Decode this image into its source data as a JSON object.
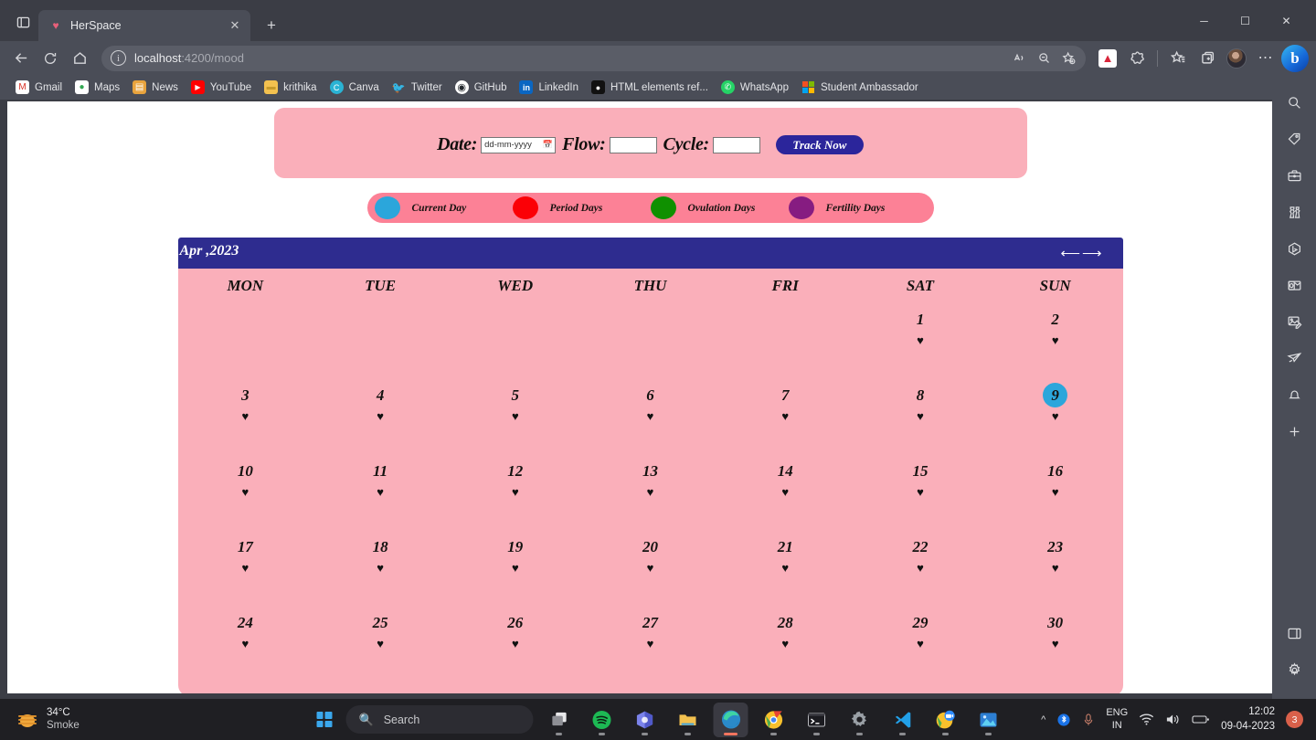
{
  "browser": {
    "tab": {
      "title": "HerSpace",
      "favicon": "heart-favicon",
      "close": "✕"
    },
    "new_tab": "+",
    "window_controls": {
      "minimize": "─",
      "maximize": "☐",
      "close": "✕"
    },
    "address": {
      "protocol_host": "localhost",
      "path": ":4200/mood",
      "info_icon": "i"
    },
    "bookmarks": [
      {
        "label": "Gmail",
        "icon": "gmail-icon",
        "glyph": "M",
        "bg": "#ffffff",
        "fg": "#d93025"
      },
      {
        "label": "Maps",
        "icon": "maps-icon",
        "glyph": "▼",
        "bg": "#ffffff",
        "fg": "#34a853"
      },
      {
        "label": "News",
        "icon": "news-icon",
        "glyph": "▤",
        "bg": "#e8a33d",
        "fg": "#ffffff"
      },
      {
        "label": "YouTube",
        "icon": "youtube-icon",
        "glyph": "▶",
        "bg": "#ff0000",
        "fg": "#ffffff"
      },
      {
        "label": "krithika",
        "icon": "folder-icon",
        "glyph": "▬",
        "bg": "#f3c14f",
        "fg": "#c79a2a"
      },
      {
        "label": "Canva",
        "icon": "canva-icon",
        "glyph": "C",
        "bg": "#2ab3d4",
        "fg": "#ffffff"
      },
      {
        "label": "Twitter",
        "icon": "twitter-icon",
        "glyph": "✈",
        "bg": "#4a4d57",
        "fg": "#1d9bf0"
      },
      {
        "label": "GitHub",
        "icon": "github-icon",
        "glyph": "●",
        "bg": "#ffffff",
        "fg": "#24292e"
      },
      {
        "label": "LinkedIn",
        "icon": "linkedin-icon",
        "glyph": "in",
        "bg": "#0a66c2",
        "fg": "#ffffff"
      },
      {
        "label": "HTML elements ref...",
        "icon": "html-ref-icon",
        "glyph": "◆",
        "bg": "#111111",
        "fg": "#ffffff"
      },
      {
        "label": "WhatsApp",
        "icon": "whatsapp-icon",
        "glyph": "✆",
        "bg": "#25d366",
        "fg": "#ffffff"
      },
      {
        "label": "Student Ambassador",
        "icon": "microsoft-icon",
        "glyph": "❖",
        "bg": "#4a4d57",
        "fg": "#ffffff"
      }
    ],
    "toolbar": {
      "back": "back-arrow",
      "refresh": "refresh",
      "home": "home",
      "read_aloud": "read-aloud",
      "zoom": "zoom-out",
      "add_favorite": "add-favorite",
      "extension": "extension-cat",
      "collections_split": "split-screen",
      "favorites": "favorites",
      "tab_groups": "tab-actions",
      "profile": "profile-avatar",
      "settings": "⋯",
      "copilot": "b"
    }
  },
  "sidebar_icons": [
    "search-icon",
    "tag-icon",
    "briefcase-icon",
    "games-icon",
    "bing-icon",
    "outlook-icon",
    "image-editor-icon",
    "send-icon",
    "bell-icon",
    "add-icon"
  ],
  "app": {
    "tracker_form": {
      "date_label": "Date:",
      "date_placeholder": "dd-mm-yyyy",
      "date_value": "",
      "flow_label": "Flow:",
      "flow_value": "",
      "cycle_label": "Cycle:",
      "cycle_value": "",
      "submit_label": "Track Now",
      "submit_color": "#2B259B",
      "panel_color": "#FAAFBA"
    },
    "legend": {
      "bar_color": "#FC8196",
      "items": [
        {
          "label": "Current Day",
          "color": "#2BA6DB"
        },
        {
          "label": "Period Days",
          "color": "#FB0006"
        },
        {
          "label": "Ovulation Days",
          "color": "#0F9000"
        },
        {
          "label": "Fertility Days",
          "color": "#861C81"
        }
      ]
    },
    "calendar": {
      "month_label": "Apr ,2023",
      "header_color": "#2E2C8F",
      "body_color": "#FAAFBA",
      "prev_arrow": "⟵",
      "next_arrow": "⟶",
      "day_names": [
        "MON",
        "TUE",
        "WED",
        "THU",
        "FRI",
        "SAT",
        "SUN"
      ],
      "current_day": 9,
      "current_day_color": "#2BA6DB",
      "heart_glyph": "♥",
      "weeks": [
        [
          null,
          null,
          null,
          null,
          null,
          1,
          2
        ],
        [
          3,
          4,
          5,
          6,
          7,
          8,
          9
        ],
        [
          10,
          11,
          12,
          13,
          14,
          15,
          16
        ],
        [
          17,
          18,
          19,
          20,
          21,
          22,
          23
        ],
        [
          24,
          25,
          26,
          27,
          28,
          29,
          30
        ]
      ]
    }
  },
  "taskbar": {
    "weather": {
      "temperature": "34°C",
      "condition": "Smoke"
    },
    "search_placeholder": "Search",
    "apps": [
      {
        "name": "task-view",
        "active": false
      },
      {
        "name": "spotify",
        "active": false
      },
      {
        "name": "office",
        "active": false
      },
      {
        "name": "file-explorer",
        "active": false
      },
      {
        "name": "microsoft-edge",
        "active": true
      },
      {
        "name": "google-chrome",
        "active": false
      },
      {
        "name": "terminal",
        "active": false
      },
      {
        "name": "settings",
        "active": false
      },
      {
        "name": "vs-code",
        "active": false
      },
      {
        "name": "zoom",
        "active": false
      },
      {
        "name": "photos",
        "active": false
      }
    ],
    "language": {
      "line1": "ENG",
      "line2": "IN"
    },
    "clock": {
      "time": "12:02",
      "date": "09-04-2023"
    },
    "notification_count": "3"
  }
}
